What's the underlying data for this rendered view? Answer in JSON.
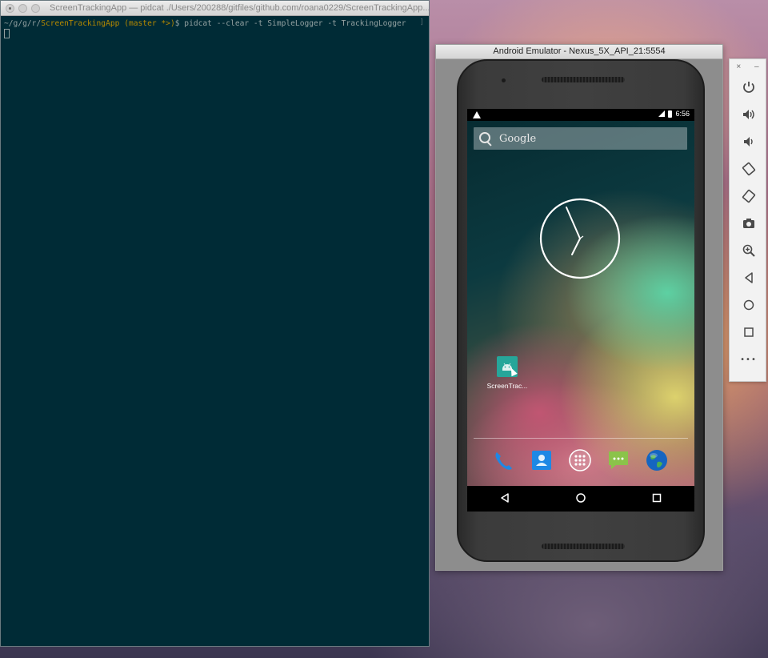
{
  "terminal": {
    "title": "ScreenTrackingApp — pidcat ./Users/200288/gitfiles/github.com/roana0229/ScreenTrackingApp...",
    "prompt_path": "~/g/g/r/",
    "prompt_app": "ScreenTrackingApp",
    "prompt_branch": " (master *>)",
    "prompt_symbol": "$ ",
    "command": "pidcat --clear -t SimpleLogger -t TrackingLogger",
    "right_mark": "]"
  },
  "emulator": {
    "window_title": "Android Emulator - Nexus_5X_API_21:5554",
    "status_time": "6:56",
    "search_placeholder": "Google",
    "app_label": "ScreenTrac...",
    "icons": {
      "dock": [
        "phone-icon",
        "contacts-icon",
        "app-drawer-icon",
        "messaging-icon",
        "browser-icon"
      ],
      "nav": [
        "back-icon",
        "home-icon",
        "recents-icon"
      ]
    },
    "colors": {
      "app_icon": "#26a69a",
      "messaging": "#8bc34a",
      "phone": "#1e88e5"
    }
  },
  "toolbar": {
    "close_label": "×",
    "minimize_label": "–",
    "more_label": "•••",
    "buttons": [
      "power-icon",
      "volume-up-icon",
      "volume-down-icon",
      "rotate-left-icon",
      "rotate-right-icon",
      "camera-icon",
      "zoom-icon",
      "back-icon",
      "home-icon",
      "overview-icon",
      "more-icon"
    ]
  }
}
